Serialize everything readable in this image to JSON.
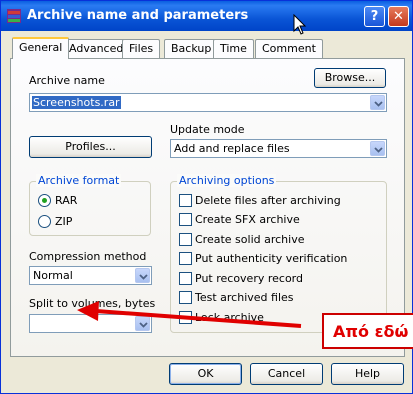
{
  "window": {
    "title": "Archive name and parameters",
    "help_glyph": "?",
    "close_glyph": "✕"
  },
  "tabs": [
    {
      "label": "General",
      "active": true
    },
    {
      "label": "Advanced"
    },
    {
      "label": "Files"
    },
    {
      "label": "Backup"
    },
    {
      "label": "Time"
    },
    {
      "label": "Comment"
    }
  ],
  "archive_name": {
    "label": "Archive name",
    "value": "Screenshots.rar",
    "browse_label": "Browse..."
  },
  "profiles_label": "Profiles...",
  "update_mode": {
    "label": "Update mode",
    "value": "Add and replace files"
  },
  "archive_format": {
    "title": "Archive format",
    "rar": "RAR",
    "zip": "ZIP",
    "selected": "RAR"
  },
  "compression": {
    "label": "Compression method",
    "value": "Normal"
  },
  "split": {
    "label": "Split to volumes, bytes",
    "value": ""
  },
  "archiving_options": {
    "title": "Archiving options",
    "items": [
      {
        "label": "Delete files after archiving",
        "checked": false
      },
      {
        "label": "Create SFX archive",
        "checked": false
      },
      {
        "label": "Create solid archive",
        "checked": false
      },
      {
        "label": "Put authenticity verification",
        "checked": false
      },
      {
        "label": "Put recovery record",
        "checked": false
      },
      {
        "label": "Test archived files",
        "checked": false
      },
      {
        "label": "Lock archive",
        "checked": false
      }
    ]
  },
  "buttons": {
    "ok": "OK",
    "cancel": "Cancel",
    "help": "Help"
  },
  "annotation": {
    "text": "Από εδώ",
    "color": "#e00000"
  },
  "colors": {
    "titlebar": "#0a55d6",
    "group_title": "#0046d5",
    "selection": "#316ac5"
  }
}
